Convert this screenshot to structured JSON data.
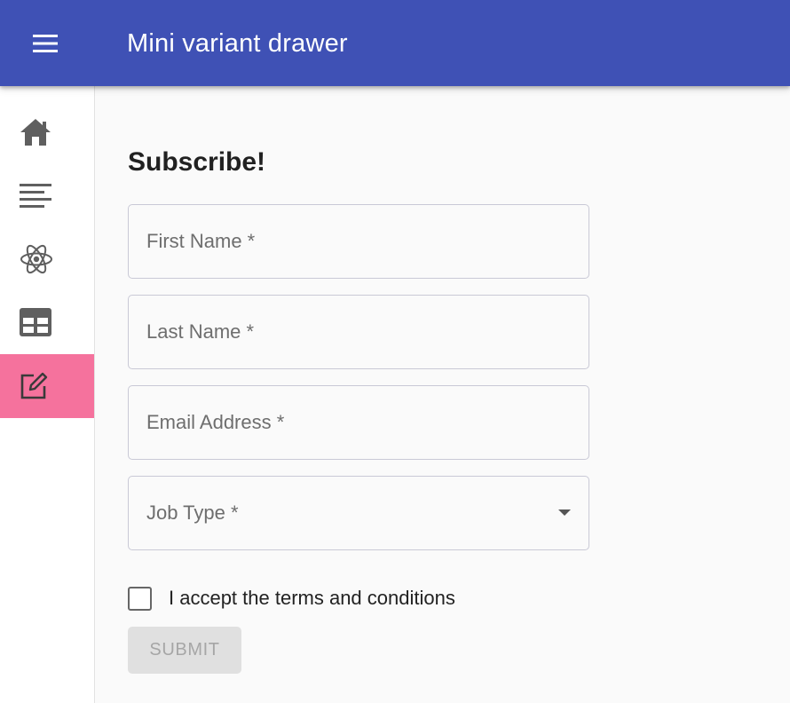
{
  "app": {
    "title": "Mini variant drawer",
    "accent_color": "#3f51b5",
    "active_item_color": "#f5729d"
  },
  "appbar": {
    "menu_icon": "menu-icon"
  },
  "drawer": {
    "items": [
      {
        "icon": "home-icon"
      },
      {
        "icon": "text-lines-icon"
      },
      {
        "icon": "react-atom-icon"
      },
      {
        "icon": "table-grid-icon"
      },
      {
        "icon": "edit-square-icon",
        "active": true
      }
    ]
  },
  "form": {
    "heading": "Subscribe!",
    "first_name_label": "First Name *",
    "last_name_label": "Last Name *",
    "email_label": "Email Address *",
    "job_type_label": "Job Type *",
    "terms_label": "I accept the terms and conditions",
    "terms_checked": false,
    "submit_label": "SUBMIT",
    "submit_disabled": true
  }
}
